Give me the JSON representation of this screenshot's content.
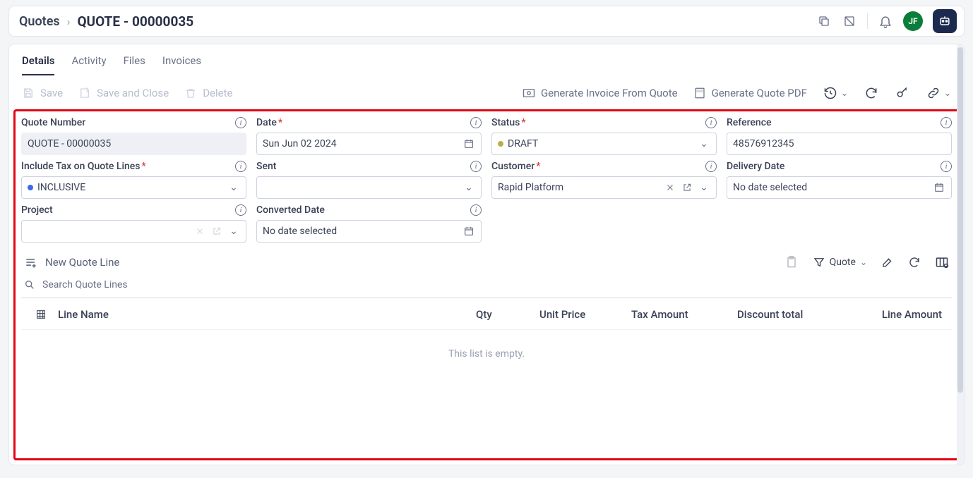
{
  "breadcrumb": {
    "root": "Quotes",
    "current": "QUOTE - 00000035"
  },
  "avatar": "JF",
  "tabs": [
    {
      "label": "Details",
      "active": true
    },
    {
      "label": "Activity",
      "active": false
    },
    {
      "label": "Files",
      "active": false
    },
    {
      "label": "Invoices",
      "active": false
    }
  ],
  "toolbar": {
    "save": "Save",
    "saveClose": "Save and Close",
    "delete": "Delete",
    "genInvoice": "Generate Invoice From Quote",
    "genPdf": "Generate Quote PDF"
  },
  "fields": {
    "quoteNumber": {
      "label": "Quote Number",
      "value": "QUOTE - 00000035"
    },
    "date": {
      "label": "Date",
      "value": "Sun Jun 02 2024"
    },
    "status": {
      "label": "Status",
      "value": "DRAFT"
    },
    "reference": {
      "label": "Reference",
      "value": "48576912345"
    },
    "includeTax": {
      "label": "Include Tax on Quote Lines",
      "value": "INCLUSIVE"
    },
    "sent": {
      "label": "Sent",
      "value": ""
    },
    "customer": {
      "label": "Customer",
      "value": "Rapid Platform"
    },
    "deliveryDate": {
      "label": "Delivery Date",
      "value": "No date selected"
    },
    "project": {
      "label": "Project",
      "value": ""
    },
    "convertedDate": {
      "label": "Converted Date",
      "value": "No date selected"
    }
  },
  "lines": {
    "newLine": "New Quote Line",
    "filterLabel": "Quote",
    "searchPlaceholder": "Search Quote Lines",
    "columns": {
      "lineName": "Line Name",
      "qty": "Qty",
      "unitPrice": "Unit Price",
      "taxAmount": "Tax Amount",
      "discountTotal": "Discount total",
      "lineAmount": "Line Amount"
    },
    "emptyMsg": "This list is empty."
  }
}
